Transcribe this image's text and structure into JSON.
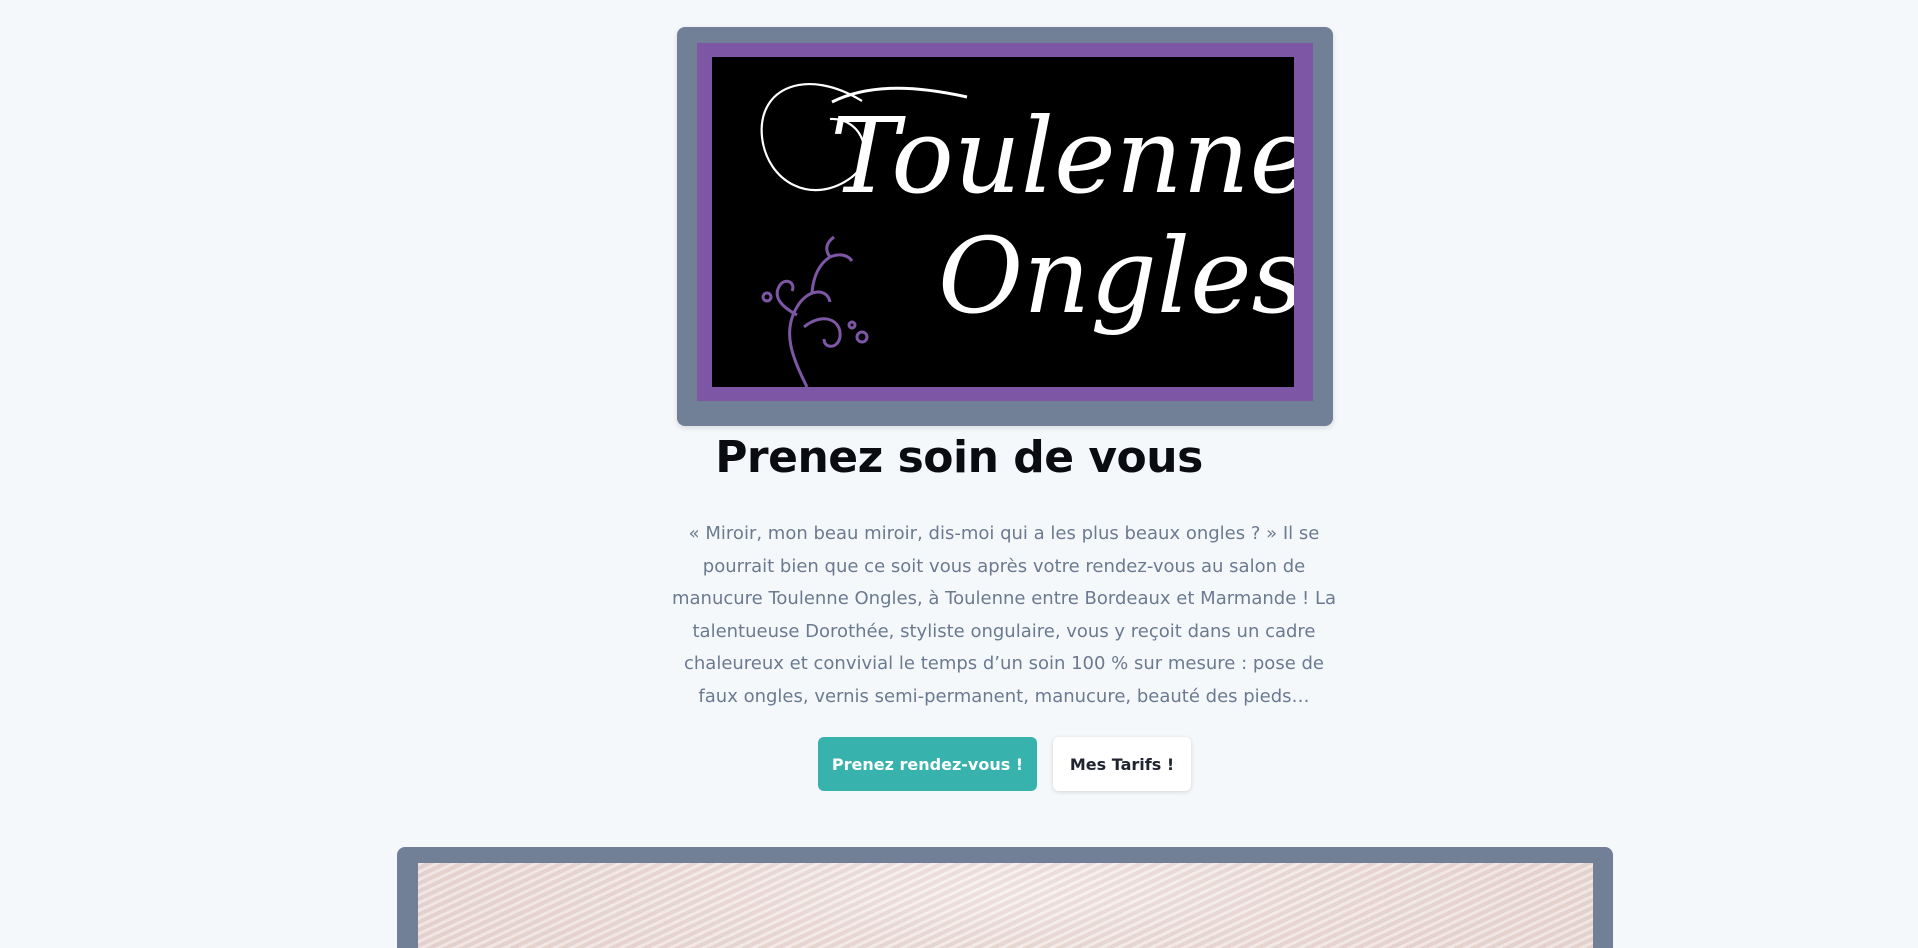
{
  "logo": {
    "line1": "Toulenne",
    "line2": "Ongles",
    "colors": {
      "frame": "#718096",
      "border": "#7d57a6",
      "background": "#000000",
      "text": "#ffffff",
      "ornament": "#7d57a6"
    }
  },
  "hero": {
    "title": "Prenez soin de vous",
    "intro": "« Miroir, mon beau miroir, dis-moi qui a les plus beaux ongles ? » Il se pourrait bien que ce soit vous après votre rendez-vous au salon de manucure Toulenne Ongles, à Toulenne entre Bordeaux et Marmande ! La talentueuse Dorothée, styliste ongulaire, vous y reçoit dans un cadre chaleureux et convivial le temps d’un soin 100 % sur mesure : pose de faux ongles, vernis semi-permanent, manucure, beauté des pieds…"
  },
  "buttons": {
    "primary_label": "Prenez rendez-vous !",
    "secondary_label": "Mes Tarifs !",
    "primary_color": "#38b2ac"
  }
}
